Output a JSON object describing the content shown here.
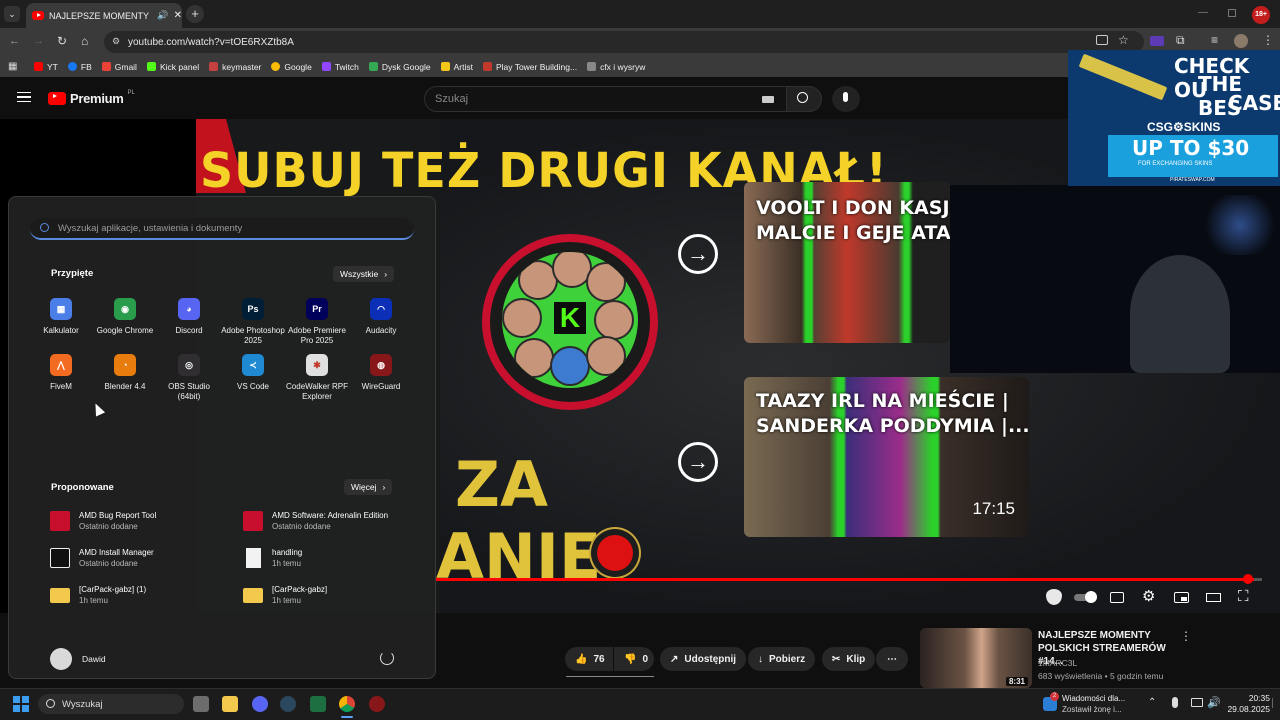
{
  "browser": {
    "tab_title": "NAJLEPSZE MOMENTY POL",
    "url": "youtube.com/watch?v=tOE6RXZtb8A",
    "bookmarks": [
      "YT",
      "FB",
      "Gmail",
      "Kick panel",
      "keymaster",
      "Google",
      "Twitch",
      "Dysk Google",
      "Artist",
      "Play Tower Building...",
      "cfx i wysryw"
    ]
  },
  "youtube": {
    "logo_text": "Premium",
    "logo_country": "PL",
    "search_placeholder": "Szukaj"
  },
  "video": {
    "banner_title": "SUBUJ TEŻ DRUGI KANAŁ!",
    "za_text": "ZA",
    "anie_text": "ANIE!",
    "end_cards": [
      {
        "title": "VOOLT I DON KASJO\nMALCIE I GEJE ATAK"
      },
      {
        "title": "TAAZY IRL NA MIEŚCIE |\nSANDERKA PODDYMIA |...",
        "duration": "17:15"
      }
    ],
    "ad": {
      "line1": "CHECK OU",
      "line2": "THE BES",
      "line3": "CASE",
      "brand": "CSG⚙SKINS",
      "offer": "UP TO $30",
      "offer_sub": "FOR EXCHANGING SKINS",
      "url": "PIRATESWAP.COM"
    },
    "progress_fraction": 0.99
  },
  "actions": {
    "likes": "76",
    "dislikes": "0",
    "share": "Udostępnij",
    "download": "Pobierz",
    "clip": "Klip",
    "more": "⋯"
  },
  "next_video": {
    "title": "NAJLEPSZE MOMENTY POLSKICH STREAMERÓW #14...",
    "channel": "1MARC3L",
    "meta": "683 wyświetlenia • 5 godzin temu",
    "duration": "8:31"
  },
  "start_menu": {
    "search_placeholder": "Wyszukaj aplikacje, ustawienia i dokumenty",
    "pinned_title": "Przypięte",
    "pinned_button": "Wszystkie",
    "pinned": [
      {
        "name": "Kalkulator",
        "color": "#4c7ee8",
        "glyph": "▦"
      },
      {
        "name": "Google Chrome",
        "color": "#2a9d4c",
        "glyph": "◉"
      },
      {
        "name": "Discord",
        "color": "#5865f2",
        "glyph": "◕"
      },
      {
        "name": "Adobe Photoshop 2025",
        "color": "#001e36",
        "glyph": "Ps"
      },
      {
        "name": "Adobe Premiere Pro 2025",
        "color": "#00005b",
        "glyph": "Pr"
      },
      {
        "name": "Audacity",
        "color": "#0b2fb6",
        "glyph": "◠"
      },
      {
        "name": "FiveM",
        "color": "#f26b21",
        "glyph": "⋀"
      },
      {
        "name": "Blender 4.4",
        "color": "#e87d0d",
        "glyph": "◔"
      },
      {
        "name": "OBS Studio (64bit)",
        "color": "#302e31",
        "glyph": "◎"
      },
      {
        "name": "VS Code",
        "color": "#1f8ad2",
        "glyph": "≺"
      },
      {
        "name": "CodeWalker RPF Explorer",
        "color": "#e0e0e0",
        "glyph": "✱"
      },
      {
        "name": "WireGuard",
        "color": "#88171a",
        "glyph": "◍"
      }
    ],
    "recommended_title": "Proponowane",
    "recommended_button": "Więcej",
    "recommended": [
      {
        "name": "AMD Bug Report Tool",
        "sub": "Ostatnio dodane",
        "icon": "amd-red"
      },
      {
        "name": "AMD Software: Adrenalin Edition",
        "sub": "Ostatnio dodane",
        "icon": "amd-red"
      },
      {
        "name": "AMD Install Manager",
        "sub": "Ostatnio dodane",
        "icon": "amd-black"
      },
      {
        "name": "handling",
        "sub": "1h temu",
        "icon": "file"
      },
      {
        "name": "[CarPack-gabz] (1)",
        "sub": "1h temu",
        "icon": "folder"
      },
      {
        "name": "[CarPack-gabz]",
        "sub": "1h temu",
        "icon": "folder"
      }
    ],
    "user": "Dawid"
  },
  "taskbar": {
    "search_label": "Wyszukaj",
    "notification_title": "Wiadomości dla...",
    "notification_sub": "Zostawił żonę i...",
    "notification_badge": "2",
    "time": "20:35",
    "date": "29.08.2025"
  }
}
